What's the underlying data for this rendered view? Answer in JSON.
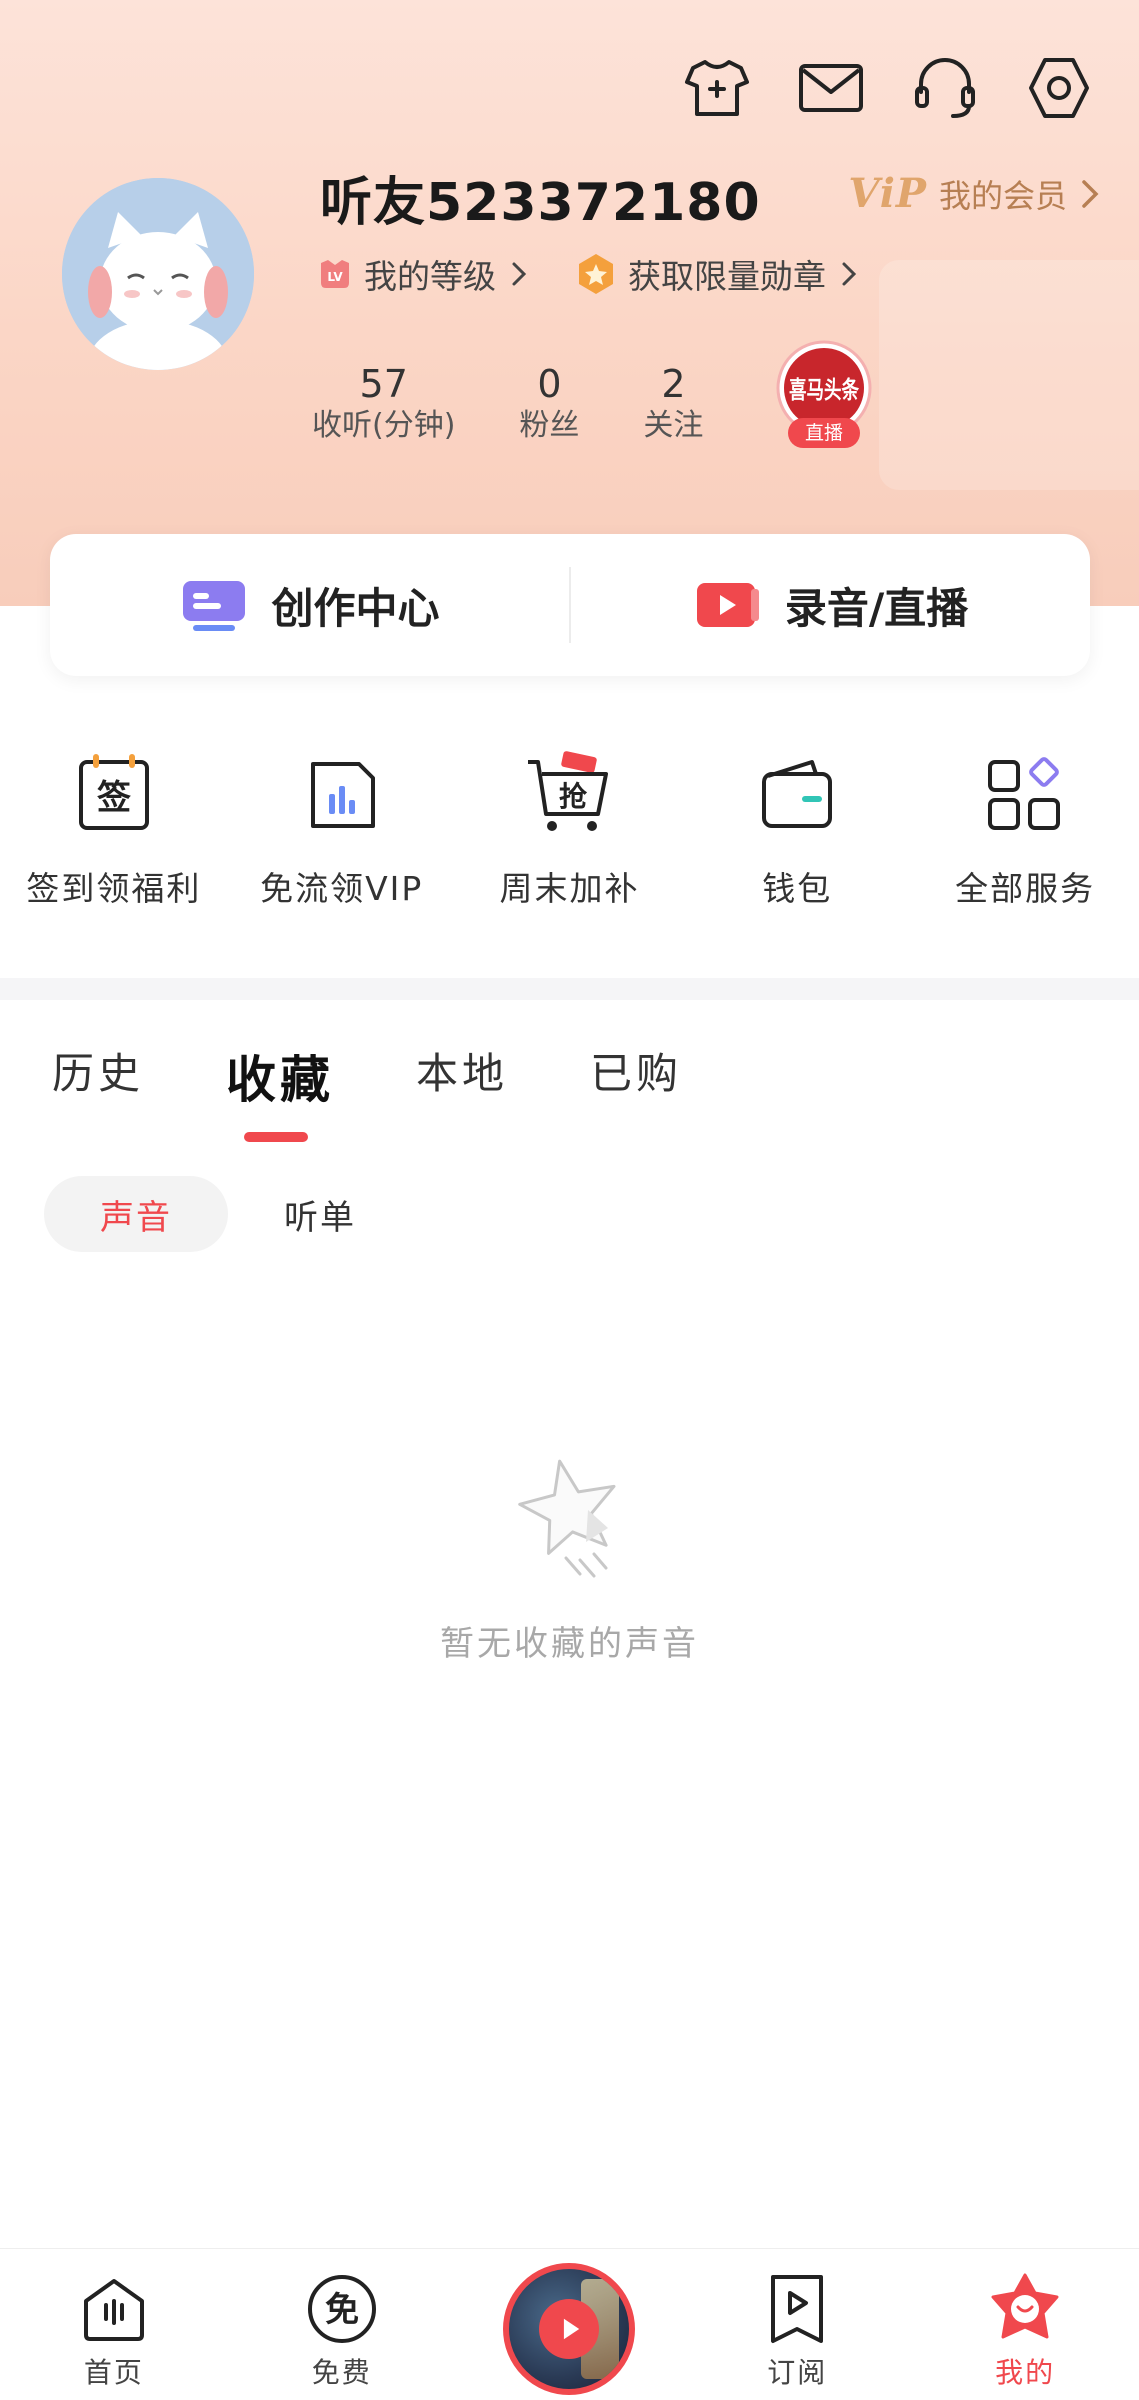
{
  "header": {
    "icons": [
      "shirt-add-icon",
      "mail-icon",
      "headset-icon",
      "settings-icon"
    ],
    "username": "听友523372180",
    "vip": {
      "logo": "ViP",
      "label": "我的会员"
    },
    "level_label": "我的等级",
    "medal_label": "获取限量勋章",
    "stats": [
      {
        "value": "57",
        "label": "收听(分钟)"
      },
      {
        "value": "0",
        "label": "粉丝"
      },
      {
        "value": "2",
        "label": "关注"
      }
    ],
    "live_badge": {
      "logo": "喜马头条",
      "label": "直播"
    }
  },
  "creator_card": {
    "left_label": "创作中心",
    "right_label": "录音/直播"
  },
  "services": [
    {
      "label": "签到领福利",
      "icon": "sign-in-icon",
      "glyph": "签"
    },
    {
      "label": "免流领VIP",
      "icon": "free-data-icon"
    },
    {
      "label": "周末加补",
      "icon": "cart-icon",
      "glyph": "抢"
    },
    {
      "label": "钱包",
      "icon": "wallet-icon"
    },
    {
      "label": "全部服务",
      "icon": "all-services-icon"
    }
  ],
  "tabs": [
    "历史",
    "收藏",
    "本地",
    "已购"
  ],
  "active_tab": "收藏",
  "subtabs": [
    "声音",
    "听单"
  ],
  "empty_text": "暂无收藏的声音",
  "bottom_nav": {
    "home": "首页",
    "free": "免费",
    "free_glyph": "免",
    "subscribe": "订阅",
    "mine": "我的"
  },
  "colors": {
    "accent": "#f0484d",
    "vip": "#e0a56c",
    "header_bg": "#fbd6c6"
  }
}
